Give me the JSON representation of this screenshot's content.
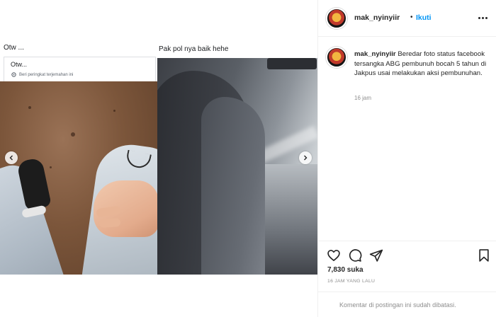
{
  "post_media": {
    "left_image": {
      "caption": "Otw ...",
      "status_text": "Otw...",
      "rate_translation": "Beri peringkat terjemahan ini"
    },
    "right_image": {
      "caption": "Pak pol nya baik hehe"
    }
  },
  "header": {
    "username": "mak_nyinyiir",
    "separator": "•",
    "follow_label": "Ikuti"
  },
  "caption": {
    "username": "mak_nyinyiir",
    "text": "Beredar foto status facebook tersangka ABG pembunuh bocah 5 tahun di Jakpus usai melakukan aksi pembunuhan.",
    "time": "16 jam"
  },
  "actions": {
    "icons": [
      "heart-icon",
      "comment-icon",
      "share-icon",
      "bookmark-icon"
    ]
  },
  "stats": {
    "likes": "7,830 suka",
    "posted": "16 JAM YANG LALU"
  },
  "comments": {
    "restricted_text": "Komentar di postingan ini sudah dibatasi."
  },
  "colors": {
    "accent": "#0095f6",
    "text": "#262626",
    "muted": "#8e8e8e",
    "border": "#efefef"
  }
}
